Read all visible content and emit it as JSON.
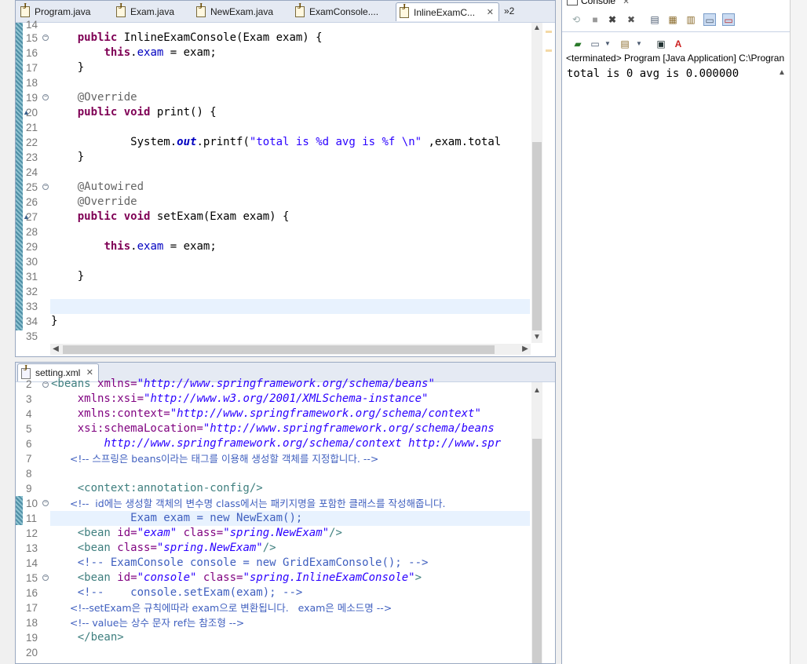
{
  "java_editor": {
    "tabs": [
      {
        "label": "Program.java"
      },
      {
        "label": "Exam.java"
      },
      {
        "label": "NewExam.java"
      },
      {
        "label": "ExamConsole...."
      },
      {
        "label": "InlineExamC...",
        "active": true
      }
    ],
    "overflow_label": "»2",
    "close_glyph": "✕",
    "lines": [
      {
        "n": "14"
      },
      {
        "n": "15"
      },
      {
        "n": "16"
      },
      {
        "n": "17"
      },
      {
        "n": "18"
      },
      {
        "n": "19"
      },
      {
        "n": "20"
      },
      {
        "n": "21"
      },
      {
        "n": "22"
      },
      {
        "n": "23"
      },
      {
        "n": "24"
      },
      {
        "n": "25"
      },
      {
        "n": "26"
      },
      {
        "n": "27"
      },
      {
        "n": "28"
      },
      {
        "n": "29"
      },
      {
        "n": "30"
      },
      {
        "n": "31"
      },
      {
        "n": "32"
      },
      {
        "n": "33"
      },
      {
        "n": "34"
      },
      {
        "n": "35"
      }
    ],
    "code": {
      "l15": [
        "public",
        " InlineExamConsole(Exam exam) {"
      ],
      "l16": [
        "this",
        ".",
        "exam",
        " = exam;"
      ],
      "l17": "}",
      "l19": "@Override",
      "l20": [
        "public",
        " ",
        "void",
        " print() {"
      ],
      "l22": [
        "System.",
        "out",
        ".printf(",
        "\"total is %d avg is %f \\n\"",
        " ,exam.total"
      ],
      "l23": "}",
      "l25": "@Autowired",
      "l26": "@Override",
      "l27": [
        "public",
        " ",
        "void",
        " setExam(Exam exam) {"
      ],
      "l29": [
        "this",
        ".",
        "exam",
        " = exam;"
      ],
      "l31": "}",
      "l34": "}"
    }
  },
  "xml_editor": {
    "tab_label": "setting.xml",
    "close_glyph": "✕",
    "lines": [
      {
        "n": "2"
      },
      {
        "n": "3"
      },
      {
        "n": "4"
      },
      {
        "n": "5"
      },
      {
        "n": "6"
      },
      {
        "n": "7"
      },
      {
        "n": "8"
      },
      {
        "n": "9"
      },
      {
        "n": "10"
      },
      {
        "n": "11"
      },
      {
        "n": "12"
      },
      {
        "n": "13"
      },
      {
        "n": "14"
      },
      {
        "n": "15"
      },
      {
        "n": "16"
      },
      {
        "n": "17"
      },
      {
        "n": "18"
      },
      {
        "n": "19"
      },
      {
        "n": "20"
      }
    ],
    "code": {
      "l2": [
        "<beans ",
        "xmlns=",
        "\"http://www.springframework.org/schema/beans\""
      ],
      "l3": [
        "xmlns:xsi=",
        "\"http://www.w3.org/2001/XMLSchema-instance\""
      ],
      "l4": [
        "xmlns:context=",
        "\"http://www.springframework.org/schema/context\""
      ],
      "l5": [
        "xsi:schemaLocation=",
        "\"http://www.springframework.org/schema/beans"
      ],
      "l6": "http://www.springframework.org/schema/context http://www.spr",
      "l7": "<!-- 스프링은 beans이라는 태그를 이용해 생성할 객체를 지정합니다. -->",
      "l9": "<context:annotation-config/>",
      "l10": "<!--  id에는 생성할 객체의 변수명 class에서는 패키지명을 포함한 클래스를 작성해줍니다.",
      "l11": "Exam exam = new NewExam();",
      "l12": [
        "<bean ",
        "id=",
        "\"exam\"",
        " class=",
        "\"spring.NewExam\"",
        "/>"
      ],
      "l13": [
        "<bean ",
        "class=",
        "\"spring.NewExam\"",
        "/>"
      ],
      "l14": "<!-- ExamConsole console = new GridExamConsole(); -->",
      "l15": [
        "<bean ",
        "id=",
        "\"console\"",
        " class=",
        "\"spring.InlineExamConsole\"",
        ">"
      ],
      "l16": "<!--    console.setExam(exam); -->",
      "l17": "<!--setExam은 규칙에따라 exam으로 변환됩니다.   exam은 메소드명 -->",
      "l18": "<!-- value는 상수 문자 ref는 참조형 -->",
      "l19": "</bean>"
    }
  },
  "console": {
    "tab_label": "Console",
    "status": "<terminated> Program [Java Application] C:\\Progran",
    "output": "total is 0 avg is 0.000000",
    "close_glyph": "✕"
  },
  "icons": {
    "scroll_up": "▲",
    "scroll_down": "▼",
    "scroll_left": "◀",
    "scroll_right": "▶"
  }
}
